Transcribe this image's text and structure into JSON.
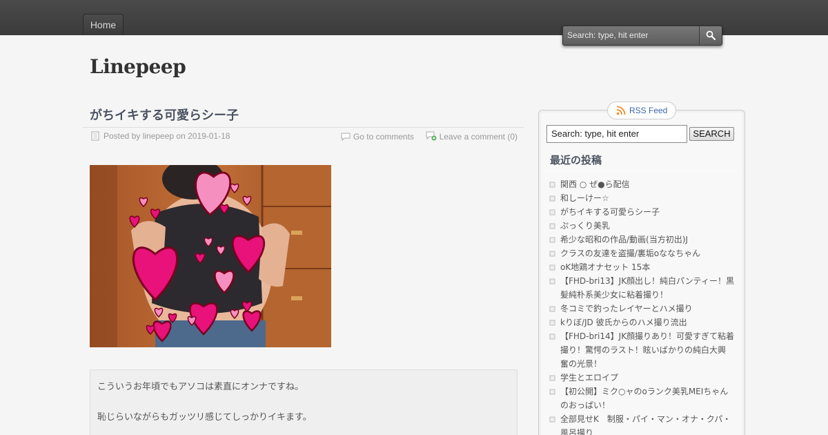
{
  "nav": {
    "home_label": "Home"
  },
  "top_search": {
    "placeholder": "Search: type, hit enter"
  },
  "site": {
    "title": "Linepeep"
  },
  "post": {
    "title": "がちイキする可愛らシー子",
    "meta": "Posted by linepeep on 2019-01-18",
    "go_to_comments": "Go to comments",
    "leave_comment": "Leave a comment (0)",
    "excerpt": [
      "こういうお年頃でもアソコは素直にオンナですね。",
      "恥じらいながらもガッツリ感じてしっかりイキます。"
    ]
  },
  "sidebar": {
    "rss_label": "RSS Feed",
    "search_value": "Search: type, hit enter",
    "search_button": "SEARCH",
    "recent_title": "最近の投稿",
    "recent_posts": [
      [
        "関西 ○ ぜ●ら配信"
      ],
      [
        "和しーけー☆"
      ],
      [
        "がちイキする可愛らシー子"
      ],
      [
        "ぷっくり美乳"
      ],
      [
        "希少な昭和の作品/動画(当方初出)J"
      ],
      [
        "クラスの友達を盗撮/裏垢oななちゃん"
      ],
      [
        "oK地鶏オナセット 15本"
      ],
      [
        "【FHD-bri13】JK顔出し！純白パンティー！黒",
        "髪純朴系美少女に粘着撮り！"
      ],
      [
        "冬コミで釣ったレイヤーとハメ撮り"
      ],
      [
        "kりぼ/JD 彼氏からのハメ撮り流出"
      ],
      [
        "【FHD-bri14】JK顔撮りあり！可愛すぎて粘着",
        "撮り！驚愕のラスト！眩いばかりの純白大興",
        "奮の光景！"
      ],
      [
        "学生とエロイプ"
      ],
      [
        "【初公開】ミク○ャのoランク美乳MEIちゃん",
        "のおっぱい！"
      ],
      [
        "全部見せK　制服・パイ・マン・オナ・クパ・",
        "風呂撮り"
      ]
    ]
  },
  "colors": {
    "topbar": "#3f3f3f",
    "link_blue": "#3b64a8",
    "heading": "#4a5260"
  }
}
